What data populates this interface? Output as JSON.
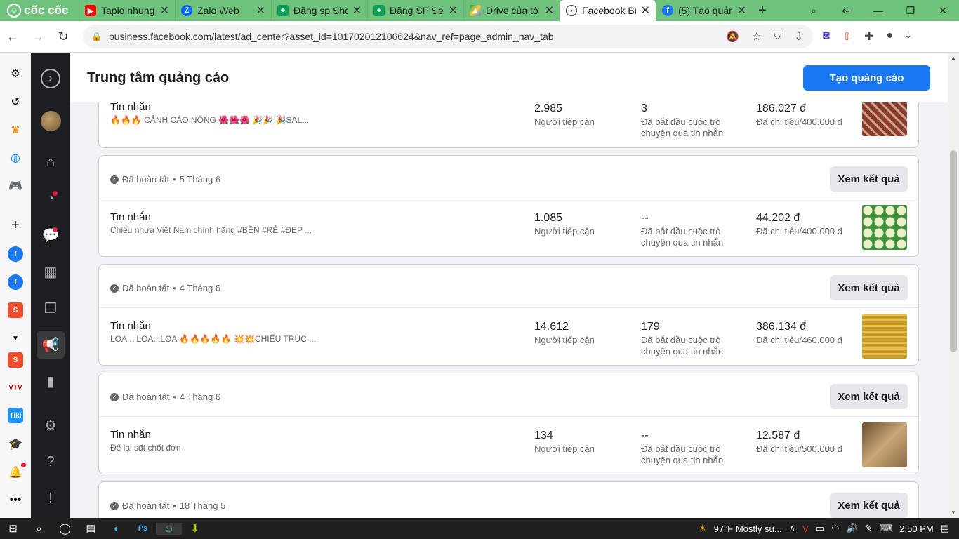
{
  "browser": {
    "brand": "cốc cốc",
    "tabs": [
      {
        "title": "Taplo nhung",
        "icon": "youtube-icon",
        "color": "#ff0000"
      },
      {
        "title": "Zalo Web",
        "icon": "zalo-icon",
        "color": "#0068ff"
      },
      {
        "title": "Đăng sp Sho",
        "icon": "sheets-icon",
        "color": "#0f9d58"
      },
      {
        "title": "Đăng SP Ser",
        "icon": "sheets-icon",
        "color": "#0f9d58"
      },
      {
        "title": "Drive của tô",
        "icon": "drive-icon",
        "color": "#4285f4"
      },
      {
        "title": "Facebook Bu",
        "icon": "meta-business-icon",
        "color": "#444444"
      },
      {
        "title": "(5) Tạo quản",
        "icon": "facebook-icon",
        "color": "#1877f2"
      }
    ],
    "url": "business.facebook.com/latest/ad_center?asset_id=101702012106624&nav_ref=page_admin_nav_tab"
  },
  "header": {
    "title": "Trung tâm quảng cáo",
    "create_label": "Tạo quảng cáo"
  },
  "ads": [
    {
      "status": "",
      "date": "",
      "type": "Tin nhắn",
      "description": "🔥🔥🔥 CẢNH CÁO NÓNG 🌺🌺🌺 🎉🎉 🎉SAL...",
      "reach": "2.985",
      "reach_label": "Người tiếp cận",
      "conversations": "3",
      "conversations_label": "Đã bắt đầu cuộc trò chuyện qua tin nhắn",
      "spend": "186.027 đ",
      "spend_label": "Đã chi tiêu/400.000 đ",
      "thumb_color": "#8c3a2c"
    },
    {
      "status": "Đã hoàn tất",
      "date": "5 Tháng 6",
      "result_label": "Xem kết quả",
      "type": "Tin nhắn",
      "description": "Chiếu nhựa Việt Nam chính hãng #BỀN #RẺ #ĐẸP ...",
      "reach": "1.085",
      "reach_label": "Người tiếp cận",
      "conversations": "--",
      "conversations_label": "Đã bắt đầu cuộc trò chuyện qua tin nhắn",
      "spend": "44.202 đ",
      "spend_label": "Đã chi tiêu/400.000 đ",
      "thumb_color": "#3f8f3a"
    },
    {
      "status": "Đã hoàn tất",
      "date": "4 Tháng 6",
      "result_label": "Xem kết quả",
      "type": "Tin nhắn",
      "description": "LOA... LOA...LOA 🔥🔥🔥🔥🔥 💥💥CHIẾU TRÚC ...",
      "reach": "14.612",
      "reach_label": "Người tiếp cận",
      "conversations": "179",
      "conversations_label": "Đã bắt đầu cuộc trò chuyện qua tin nhắn",
      "spend": "386.134 đ",
      "spend_label": "Đã chi tiêu/460.000 đ",
      "thumb_color": "#c89a22"
    },
    {
      "status": "Đã hoàn tất",
      "date": "4 Tháng 6",
      "result_label": "Xem kết quả",
      "type": "Tin nhắn",
      "description": "Để lại sđt chốt đơn",
      "reach": "134",
      "reach_label": "Người tiếp cận",
      "conversations": "--",
      "conversations_label": "Đã bắt đầu cuộc trò chuyện qua tin nhắn",
      "spend": "12.587 đ",
      "spend_label": "Đã chi tiêu/500.000 đ",
      "thumb_color": "#9c7a4e"
    },
    {
      "status": "Đã hoàn tất",
      "date": "18 Tháng 5",
      "result_label": "Xem kết quả"
    }
  ],
  "taskbar": {
    "weather": "97°F  Mostly su...",
    "time": "2:50 PM"
  },
  "colors": {
    "accent": "#1877f2",
    "tabbar": "#6ec27c",
    "nav_rail": "#1c1e21"
  }
}
